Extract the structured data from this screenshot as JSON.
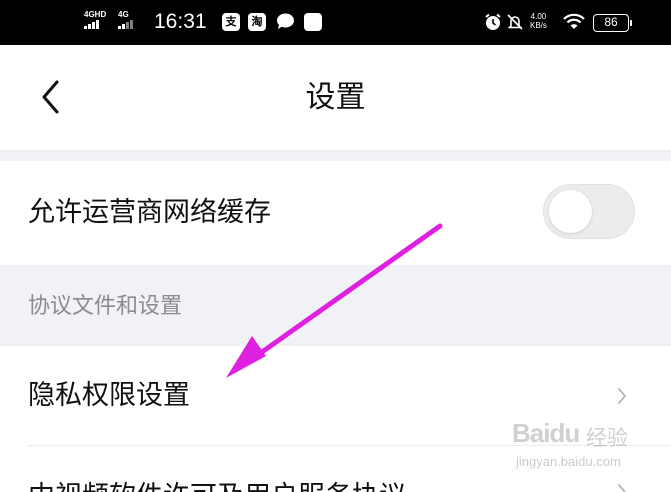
{
  "status_bar": {
    "network_1": "4GHD",
    "network_2": "4G",
    "time": "16:31",
    "app_icon_1": "支",
    "app_icon_2": "淘",
    "speed_value": "4.00",
    "speed_unit": "KB/s",
    "battery": "86",
    "icons": [
      "signal-icon",
      "alipay-icon",
      "taobao-icon",
      "chat-bubble-icon",
      "app-square-icon",
      "alarm-icon",
      "mute-icon",
      "wifi-icon",
      "battery-icon"
    ]
  },
  "header": {
    "title": "设置",
    "back_icon": "chevron-left-icon"
  },
  "settings": {
    "cache_row": {
      "label": "允许运营商网络缓存",
      "toggle_on": false
    },
    "section_title": "协议文件和设置",
    "privacy_row": {
      "label": "隐私权限设置",
      "icon": "chevron-right-icon"
    },
    "license_row": {
      "label": "中视频软件许可及用户服务协议",
      "icon": "chevron-right-icon"
    }
  },
  "annotation": {
    "color": "#e020e0"
  },
  "watermark": {
    "brand": "Baidu",
    "suffix": "经验",
    "url": "jingyan.baidu.com"
  }
}
